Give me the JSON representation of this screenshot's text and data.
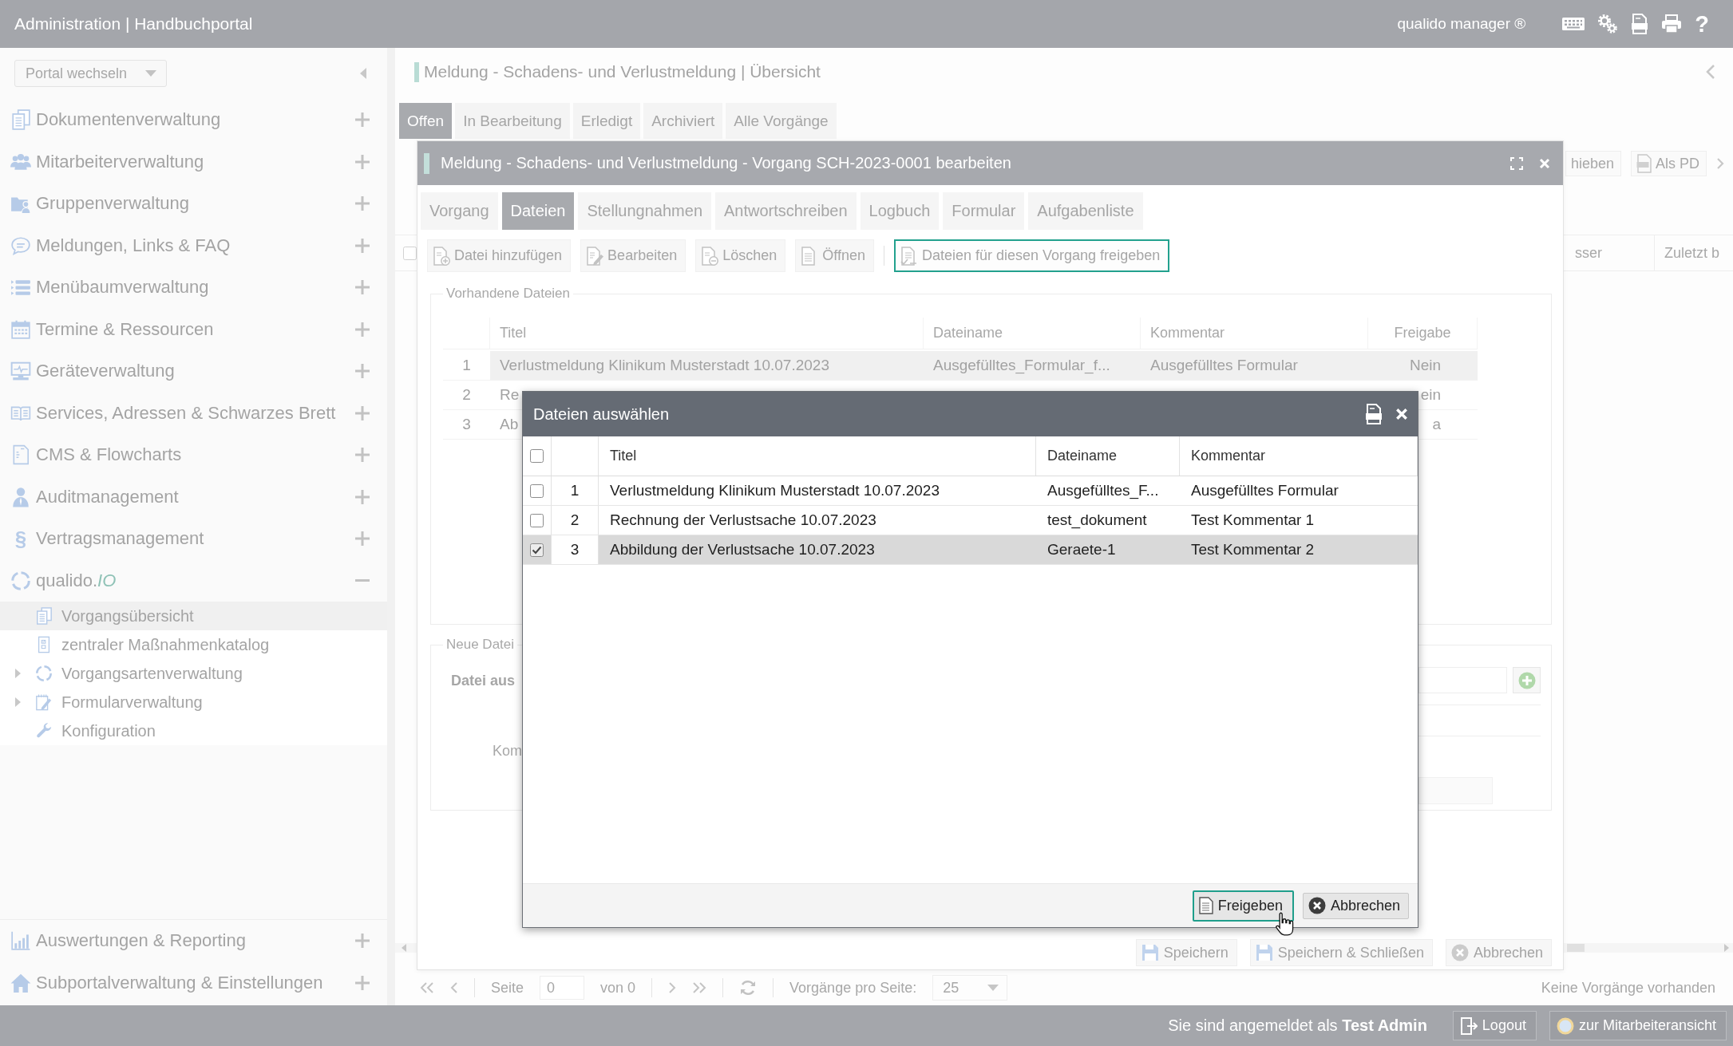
{
  "topbar": {
    "title": "Administration | Handbuchportal",
    "product": "qualido manager ®",
    "help": "?"
  },
  "sidebar": {
    "portal_select": "Portal wechseln",
    "items": [
      {
        "label": "Dokumentenverwaltung",
        "expanded": false
      },
      {
        "label": "Mitarbeiterverwaltung",
        "expanded": false
      },
      {
        "label": "Gruppenverwaltung",
        "expanded": false
      },
      {
        "label": "Meldungen, Links & FAQ",
        "expanded": false
      },
      {
        "label": "Menübaumverwaltung",
        "expanded": false
      },
      {
        "label": "Termine & Ressourcen",
        "expanded": false
      },
      {
        "label": "Geräteverwaltung",
        "expanded": false
      },
      {
        "label": "Services, Adressen & Schwarzes Brett",
        "expanded": false
      },
      {
        "label": "CMS & Flowcharts",
        "expanded": false
      },
      {
        "label": "Auditmanagement",
        "expanded": false
      },
      {
        "label": "Vertragsmanagement",
        "glyph": "§",
        "expanded": false
      },
      {
        "label": "qualido.*IO*",
        "expanded": true,
        "children": [
          {
            "label": "Vorgangsübersicht",
            "selected": true,
            "expandable": false
          },
          {
            "label": "zentraler Maßnahmenkatalog",
            "selected": false,
            "expandable": false
          },
          {
            "label": "Vorgangsartenverwaltung",
            "selected": false,
            "expandable": true
          },
          {
            "label": "Formularverwaltung",
            "selected": false,
            "expandable": true
          },
          {
            "label": "Konfiguration",
            "selected": false,
            "expandable": false
          }
        ]
      }
    ],
    "bottom_items": [
      {
        "label": "Auswertungen & Reporting",
        "expanded": false
      },
      {
        "label": "Subportalverwaltung & Einstellungen",
        "expanded": false
      }
    ]
  },
  "main": {
    "title": "Meldung - Schadens- und Verlustmeldung | Übersicht",
    "tabs": [
      {
        "label": "Offen",
        "selected": true
      },
      {
        "label": "In Bearbeitung",
        "selected": false
      },
      {
        "label": "Erledigt",
        "selected": false
      },
      {
        "label": "Archiviert",
        "selected": false
      },
      {
        "label": "Alle Vorgänge",
        "selected": false
      }
    ],
    "toolbar": [
      "hieben",
      "Als PD"
    ],
    "select_all": false,
    "columns": [
      "sser",
      "Zuletzt b"
    ],
    "pager": {
      "page_label": "Seite",
      "page": "0",
      "of": "von 0",
      "per_page_label": "Vorgänge pro Seite:",
      "per_page": "25",
      "status": "Keine Vorgänge vorhanden"
    }
  },
  "edit_dialog": {
    "title": "Meldung - Schadens- und Verlustmeldung - Vorgang SCH-2023-0001 bearbeiten",
    "tabs": [
      {
        "label": "Vorgang",
        "selected": false
      },
      {
        "label": "Dateien",
        "selected": true
      },
      {
        "label": "Stellungnahmen",
        "selected": false
      },
      {
        "label": "Antwortschreiben",
        "selected": false
      },
      {
        "label": "Logbuch",
        "selected": false
      },
      {
        "label": "Formular",
        "selected": false
      },
      {
        "label": "Aufgabenliste",
        "selected": false
      }
    ],
    "toolbar": [
      {
        "label": "Datei hinzufügen",
        "focused": false
      },
      {
        "label": "Bearbeiten",
        "focused": false
      },
      {
        "label": "Löschen",
        "focused": false
      },
      {
        "label": "Öffnen",
        "focused": false
      },
      {
        "label": "Dateien für diesen Vorgang freigeben",
        "focused": true
      }
    ],
    "existing": {
      "legend": "Vorhandene Dateien",
      "columns": [
        "Titel",
        "Dateiname",
        "Kommentar",
        "Freigabe"
      ],
      "rows": [
        {
          "number": "1",
          "title": "Verlustmeldung Klinikum Musterstadt 10.07.2023",
          "file": "Ausgefülltes_Formular_f...",
          "comment": "Ausgefülltes Formular",
          "release": "Nein",
          "selected": true
        },
        {
          "number": "2",
          "title": "Re",
          "release": "ein",
          "selected": false
        },
        {
          "number": "3",
          "title": "Ab",
          "release": "a",
          "selected": false
        }
      ]
    },
    "new_file": {
      "legend": "Neue Datei",
      "file_label": "Datei aus",
      "comment_label": "Kom"
    },
    "buttons": [
      "Speichern",
      "Speichern & Schließen",
      "Abbrechen"
    ]
  },
  "file_picker": {
    "title": "Dateien auswählen",
    "all_checked": false,
    "columns": [
      "Titel",
      "Dateiname",
      "Kommentar"
    ],
    "rows": [
      {
        "number": "1",
        "title": "Verlustmeldung Klinikum Musterstadt 10.07.2023",
        "file": "Ausgefülltes_F...",
        "comment": "Ausgefülltes Formular",
        "checked": false,
        "selected": false
      },
      {
        "number": "2",
        "title": "Rechnung der Verlustsache 10.07.2023",
        "file": "test_dokument",
        "comment": "Test Kommentar 1",
        "checked": false,
        "selected": false
      },
      {
        "number": "3",
        "title": "Abbildung der Verlustsache 10.07.2023",
        "file": "Geraete-1",
        "comment": "Test Kommentar 2",
        "checked": true,
        "selected": true
      }
    ],
    "buttons": [
      {
        "label": "Freigeben",
        "focused": true
      },
      {
        "label": "Abbrechen",
        "focused": false
      }
    ]
  },
  "footer": {
    "status": "Sie sind angemeldet als **Test Admin**",
    "buttons": [
      "Logout",
      "zur Mitarbeiteransicht"
    ]
  }
}
